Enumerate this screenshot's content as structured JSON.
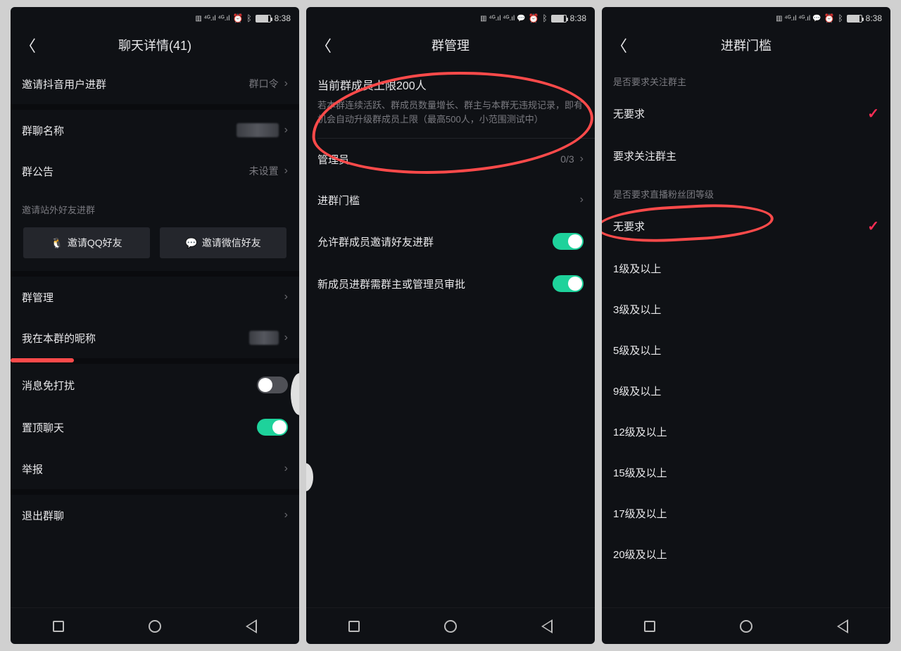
{
  "status": {
    "time": "8:38",
    "icons_text": "HD 4G 4G"
  },
  "screen1": {
    "title": "聊天详情(41)",
    "invite_douyin": "邀请抖音用户进群",
    "invite_douyin_value": "群口令",
    "group_name_label": "群聊名称",
    "announcement_label": "群公告",
    "announcement_value": "未设置",
    "invite_external_caption": "邀请站外好友进群",
    "btn_qq": "邀请QQ好友",
    "btn_wechat": "邀请微信好友",
    "group_manage": "群管理",
    "my_nickname": "我在本群的昵称",
    "mute": "消息免打扰",
    "pin": "置顶聊天",
    "report": "举报",
    "leave": "退出群聊"
  },
  "screen2": {
    "title": "群管理",
    "limit_title": "当前群成员上限200人",
    "limit_desc": "若本群连续活跃、群成员数量增长、群主与本群无违规记录，即有机会自动升级群成员上限（最高500人，小范围测试中）",
    "admin_label": "管理员",
    "admin_value": "0/3",
    "threshold_label": "进群门槛",
    "allow_invite": "允许群成员邀请好友进群",
    "need_approval": "新成员进群需群主或管理员审批"
  },
  "screen3": {
    "title": "进群门槛",
    "section1": "是否要求关注群主",
    "opt_none": "无要求",
    "opt_follow": "要求关注群主",
    "section2": "是否要求直播粉丝团等级",
    "levels": [
      "无要求",
      "1级及以上",
      "3级及以上",
      "5级及以上",
      "9级及以上",
      "12级及以上",
      "15级及以上",
      "17级及以上",
      "20级及以上"
    ]
  }
}
